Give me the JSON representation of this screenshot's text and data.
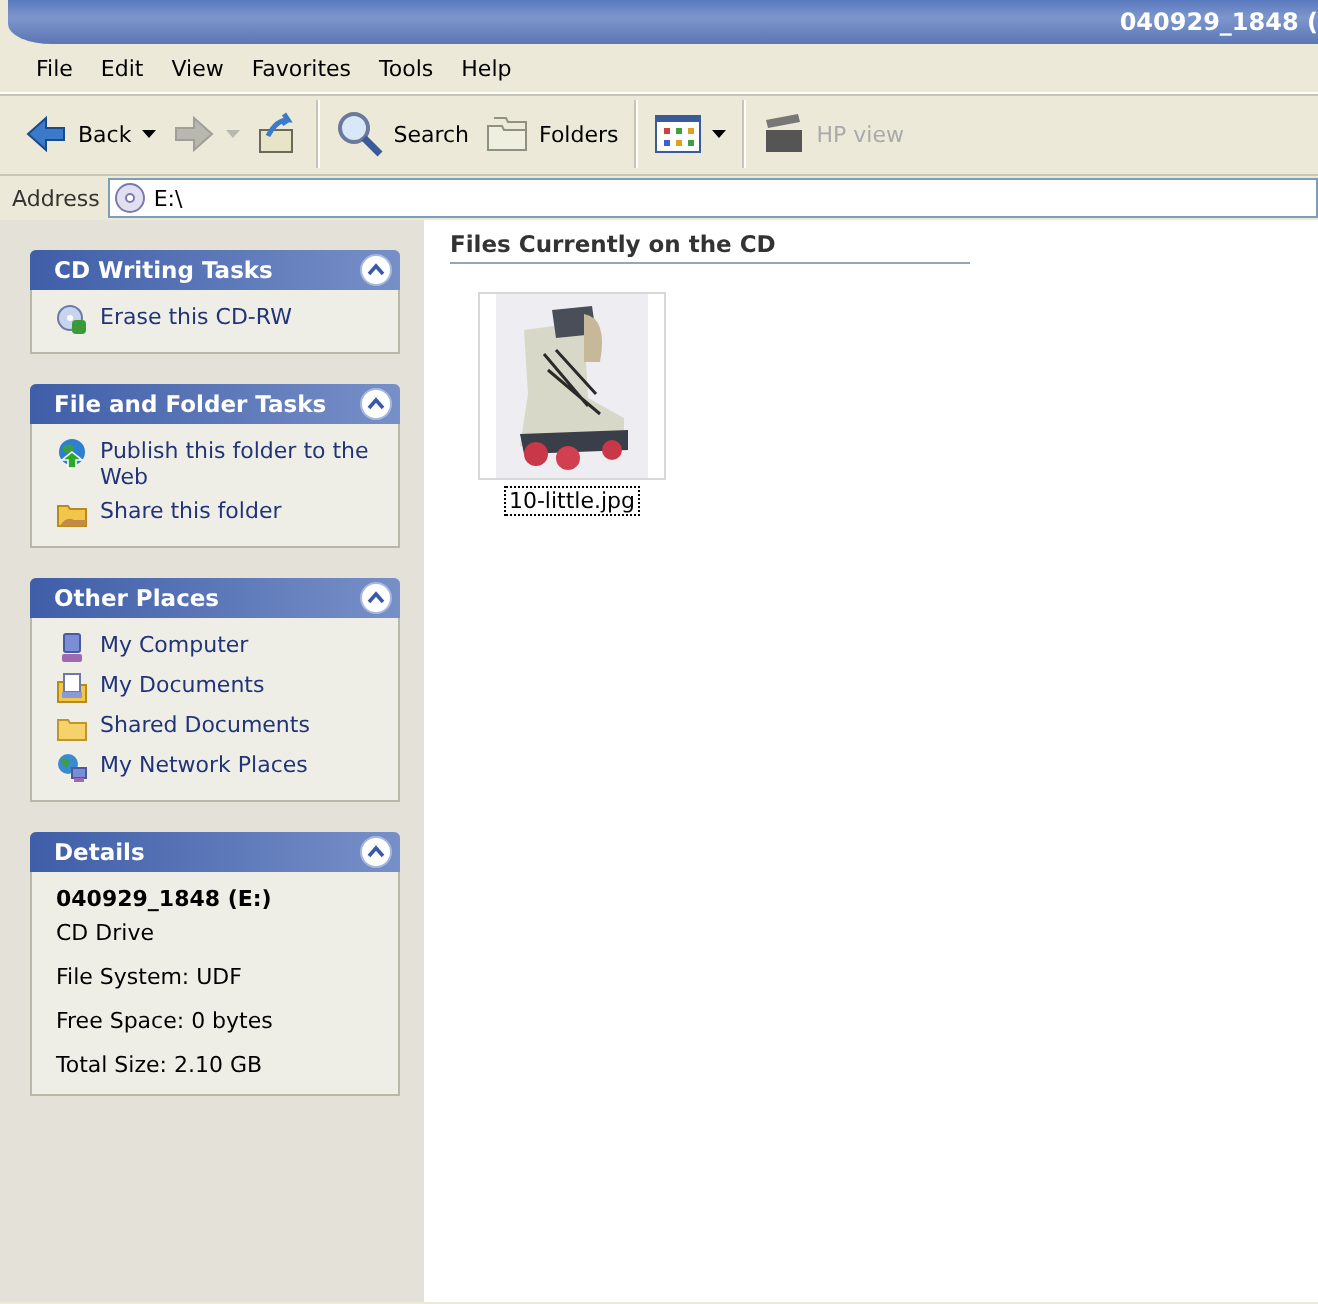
{
  "window": {
    "title": "040929_1848 ("
  },
  "menu": [
    "File",
    "Edit",
    "View",
    "Favorites",
    "Tools",
    "Help"
  ],
  "toolbar": [
    {
      "kind": "back",
      "label": "Back",
      "disabled": false
    },
    {
      "kind": "forward",
      "disabled": true
    },
    {
      "kind": "up",
      "disabled": false
    },
    {
      "kind": "search",
      "label": "Search",
      "disabled": false
    },
    {
      "kind": "folders",
      "label": "Folders",
      "disabled": false
    },
    {
      "kind": "views",
      "disabled": false
    },
    {
      "kind": "hpview",
      "label": "HP view",
      "disabled": true
    }
  ],
  "address": {
    "label": "Address",
    "value": "E:\\"
  },
  "task_panes": [
    {
      "kind": "links",
      "title": "CD Writing Tasks",
      "items": [
        {
          "kind": "cd",
          "label": "Erase this CD-RW"
        }
      ]
    },
    {
      "kind": "links",
      "title": "File and Folder Tasks",
      "items": [
        {
          "kind": "globe",
          "label": "Publish this folder to the Web"
        },
        {
          "kind": "share",
          "label": "Share this folder"
        }
      ]
    },
    {
      "kind": "links",
      "title": "Other Places",
      "items": [
        {
          "kind": "computer",
          "label": "My Computer"
        },
        {
          "kind": "documents",
          "label": "My Documents"
        },
        {
          "kind": "folder",
          "label": "Shared Documents"
        },
        {
          "kind": "network",
          "label": "My Network Places"
        }
      ]
    },
    {
      "kind": "details",
      "title": "Details",
      "heading": "040929_1848 (E:)",
      "lines": [
        "CD Drive",
        "File System: UDF",
        "Free Space: 0 bytes",
        "Total Size: 2.10 GB"
      ]
    }
  ],
  "files_section": {
    "title": "Files Currently on the CD",
    "files": [
      {
        "name": "10-little.jpg",
        "focused": true,
        "kind": "picture"
      }
    ]
  }
}
